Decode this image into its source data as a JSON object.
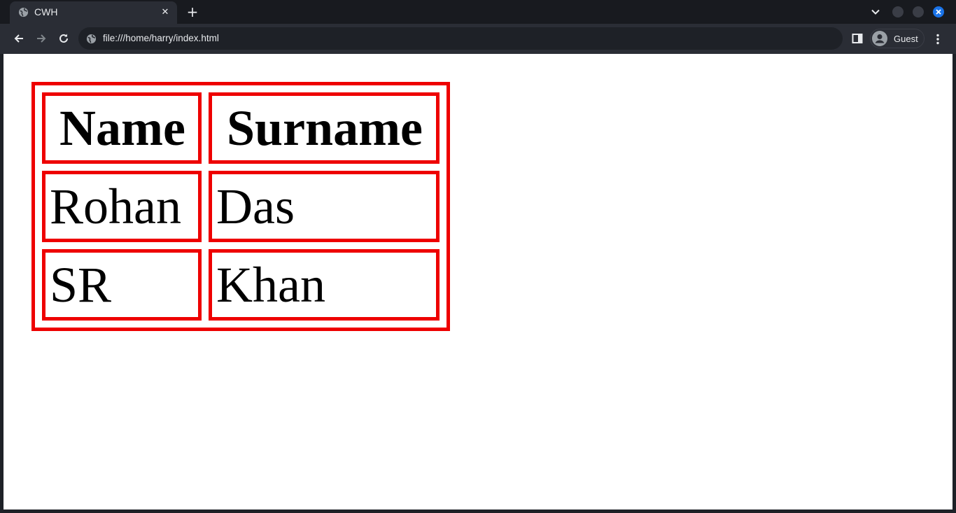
{
  "browser": {
    "tab_title": "CWH",
    "url": "file:///home/harry/index.html",
    "profile_label": "Guest"
  },
  "table": {
    "headers": [
      "Name",
      "Surname"
    ],
    "rows": [
      [
        "Rohan",
        "Das"
      ],
      [
        "SR",
        "Khan"
      ]
    ]
  },
  "colors": {
    "border": "#ee0000",
    "accent": "#1a73e8"
  }
}
